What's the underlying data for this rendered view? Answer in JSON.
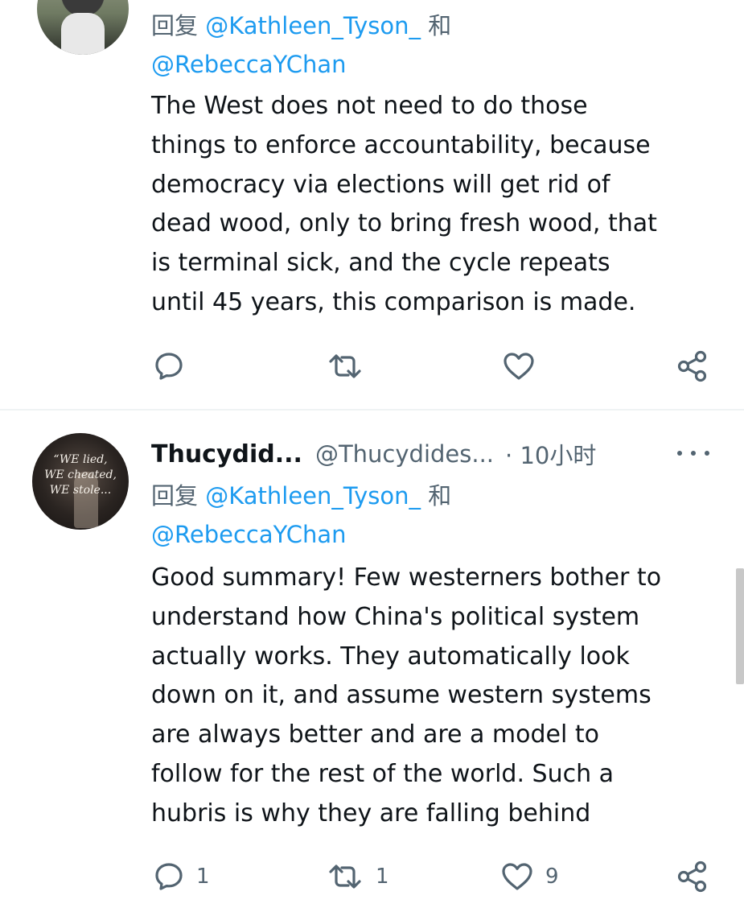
{
  "tweets": [
    {
      "reply_prefix": "回复",
      "reply_mention_1": "@Kathleen_Tyson_",
      "reply_and": "和",
      "reply_mention_2": "@RebeccaYChan",
      "lines": [
        "The West does not need to do those",
        "things to enforce accountability, because",
        "democracy via elections will get rid of",
        "dead wood, only to bring fresh wood, that",
        "is terminal sick, and the cycle repeats",
        "until 45 years, this comparison is made."
      ],
      "actions": {
        "reply_icon": "reply-bubble-icon",
        "retweet_icon": "retweet-icon",
        "like_icon": "heart-icon",
        "share_icon": "share-icon"
      }
    },
    {
      "display_name": "Thucydid...",
      "handle": "@Thucydides...",
      "time": "· 10小时",
      "avatar_text": [
        "“WE lied,",
        "WE cheated,",
        "WE stole..."
      ],
      "reply_prefix": "回复",
      "reply_mention_1": "@Kathleen_Tyson_",
      "reply_and": "和",
      "reply_mention_2": "@RebeccaYChan",
      "lines": [
        "Good summary! Few westerners bother to",
        "understand how China's political system",
        "actually works. They automatically look",
        "down on it, and assume western systems",
        "are always better and are a model to",
        "follow for the rest of the world. Such a",
        "hubris is why they are falling behind"
      ],
      "actions": {
        "reply_count": "1",
        "retweet_count": "1",
        "like_count": "9"
      }
    }
  ],
  "colors": {
    "text": "#0f1419",
    "secondary": "#536471",
    "link": "#1d9bf0",
    "divider": "#eff3f4"
  }
}
